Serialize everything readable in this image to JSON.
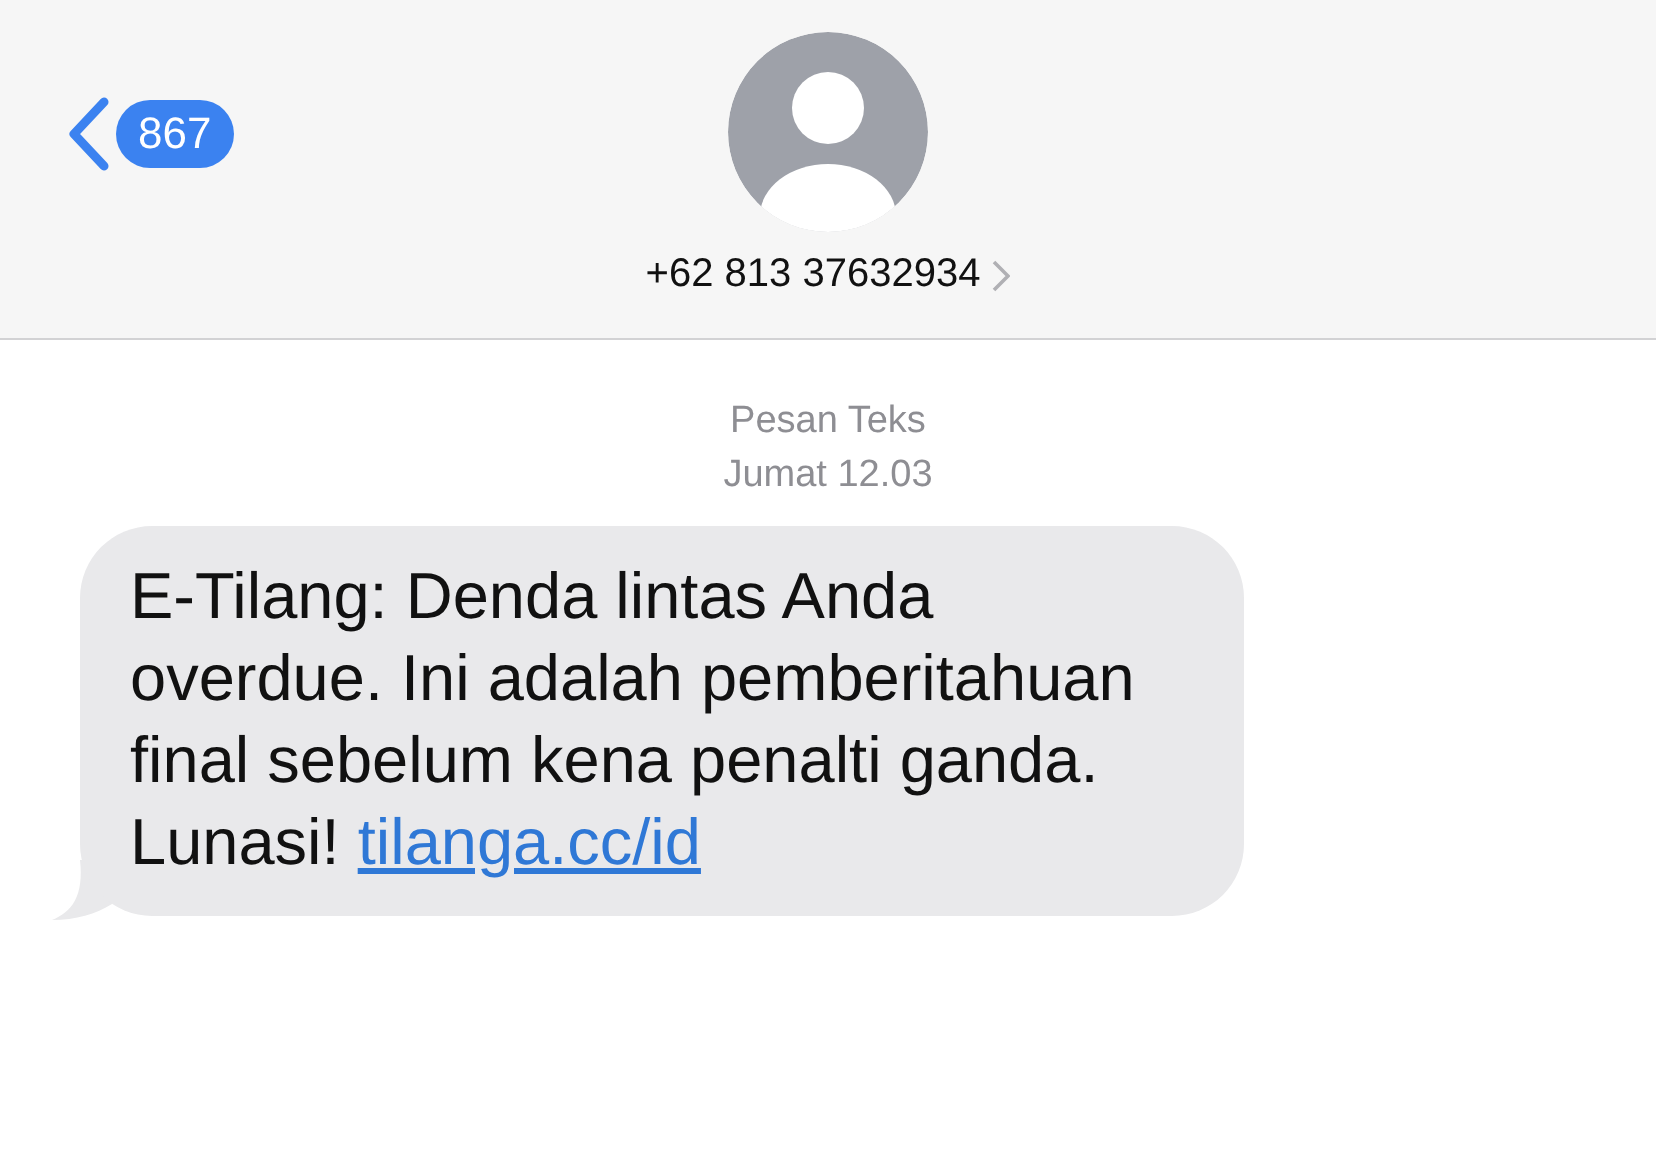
{
  "header": {
    "back_count": "867",
    "contact": "+62 813 37632934"
  },
  "thread": {
    "label": "Pesan Teks",
    "time": "Jumat 12.03"
  },
  "messages": [
    {
      "text": "E-Tilang: Denda lintas Anda overdue. Ini adalah pemberitahuan final sebelum kena penalti ganda. Lunasi!",
      "link": "tilanga.cc/id"
    }
  ]
}
